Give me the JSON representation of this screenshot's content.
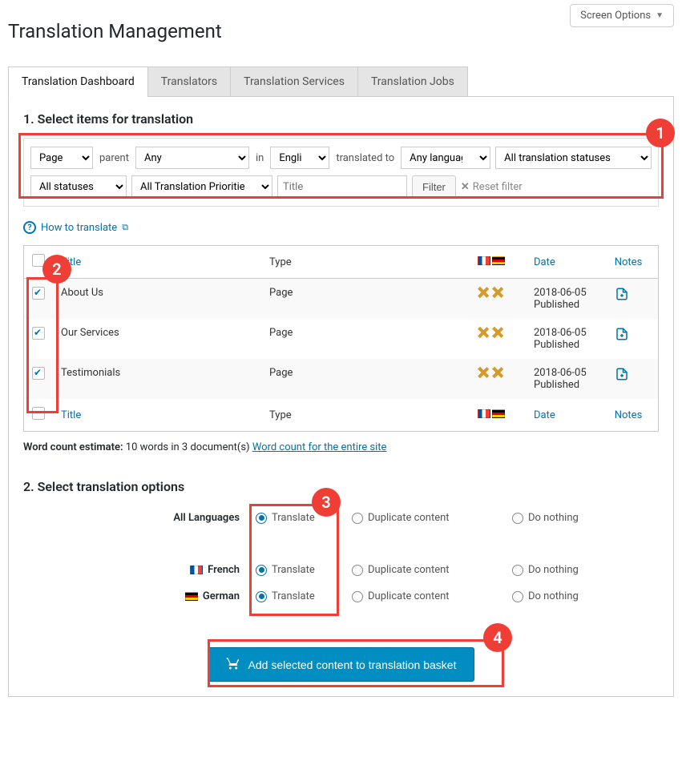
{
  "screen_options_label": "Screen Options",
  "page_title": "Translation Management",
  "tabs": [
    {
      "label": "Translation Dashboard",
      "active": true
    },
    {
      "label": "Translators"
    },
    {
      "label": "Translation Services"
    },
    {
      "label": "Translation Jobs"
    }
  ],
  "section1_title": "1. Select items for translation",
  "filters": {
    "type": "Page",
    "parent_label": "parent",
    "parent_value": "Any",
    "in_label": "in",
    "from_lang": "English",
    "translated_to_label": "translated to",
    "to_lang": "Any language",
    "trans_status": "All translation statuses",
    "post_status": "All statuses",
    "priority": "All Translation Priorities",
    "title_placeholder": "Title",
    "filter_btn": "Filter",
    "reset_label": "Reset filter"
  },
  "howto_label": "How to translate",
  "table": {
    "col_title": "Title",
    "col_type": "Type",
    "col_date": "Date",
    "col_notes": "Notes",
    "rows": [
      {
        "title": "About Us",
        "type": "Page",
        "date": "2018-06-05",
        "pub": "Published"
      },
      {
        "title": "Our Services",
        "type": "Page",
        "date": "2018-06-05",
        "pub": "Published"
      },
      {
        "title": "Testimonials",
        "type": "Page",
        "date": "2018-06-05",
        "pub": "Published"
      }
    ]
  },
  "wordcount": {
    "label": "Word count estimate:",
    "text": "10 words in 3 document(s)",
    "link": "Word count for the entire site"
  },
  "section2_title": "2. Select translation options",
  "options": {
    "all_lang_label": "All Languages",
    "french_label": "French",
    "german_label": "German",
    "translate": "Translate",
    "duplicate": "Duplicate content",
    "nothing": "Do nothing"
  },
  "add_button": "Add selected content to translation basket",
  "callouts": {
    "c1": "1",
    "c2": "2",
    "c3": "3",
    "c4": "4"
  }
}
